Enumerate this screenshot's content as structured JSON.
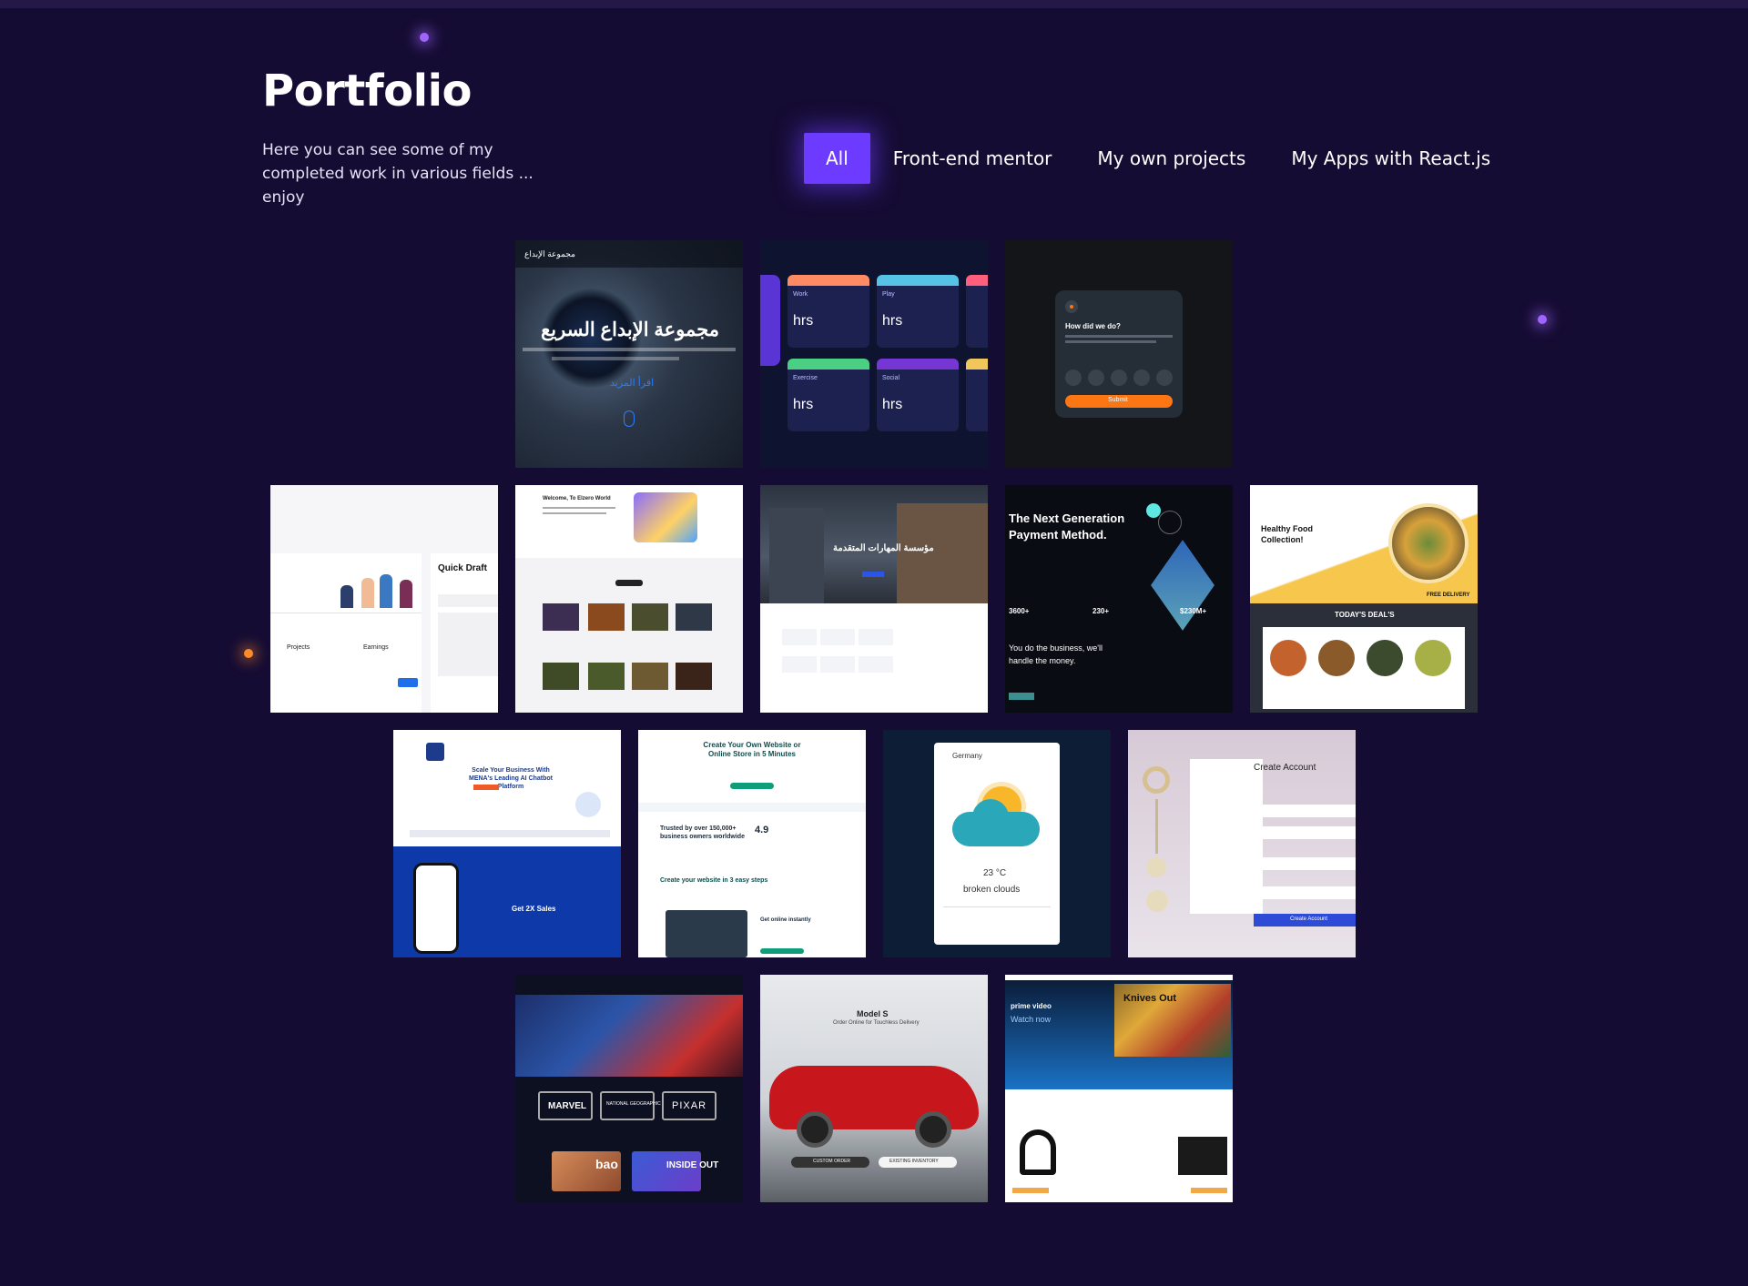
{
  "header": {
    "title": "Portfolio",
    "subtitle": "Here you can see some of my completed work in various fields ... enjoy"
  },
  "filters": [
    {
      "label": "All",
      "active": true
    },
    {
      "label": "Front-end mentor",
      "active": false
    },
    {
      "label": "My own projects",
      "active": false
    },
    {
      "label": "My Apps with React.js",
      "active": false
    }
  ],
  "colors": {
    "background": "#150c33",
    "accent": "#6c3bff",
    "text": "#ffffff"
  },
  "projects": {
    "arabic_agency": {
      "heading": "مجموعة الإبداع السريع",
      "cta": "اقرأ المزيد",
      "brand": "مجموعة الإبداع"
    },
    "time_tracker": {
      "cards": [
        {
          "name": "Work",
          "value": "hrs"
        },
        {
          "name": "Play",
          "value": "hrs"
        },
        {
          "name": "Exercise",
          "value": "hrs"
        },
        {
          "name": "Social",
          "value": "hrs"
        }
      ]
    },
    "rating": {
      "question": "How did we do?",
      "button": "Submit",
      "numbers": [
        "1",
        "2",
        "3",
        "4",
        "5"
      ]
    },
    "dashboard": {
      "heading": "Quick Draft",
      "projects_label": "Projects",
      "earnings_label": "Earnings"
    },
    "elzero": {
      "heading": "Welcome, To Elzero World"
    },
    "arabic_real_estate": {
      "heading": "مؤسسة المهارات المتقدمة"
    },
    "payment": {
      "heading": "The Next Generation Payment Method.",
      "stat1": "3600+",
      "stat2": "230+",
      "stat3": "$230M+",
      "tagline": "You do the business, we'll handle the money."
    },
    "food": {
      "heading": "Healthy Food Collection!",
      "deals": "TODAY'S DEAL'S",
      "badge": "FREE DELIVERY"
    },
    "chatbot": {
      "heading": "Scale Your Business With MENA's Leading AI Chatbot Platform",
      "sales": "Get 2X Sales"
    },
    "website_builder": {
      "heading": "Create Your Own Website or Online Store in 5 Minutes",
      "trust": "Trusted by over 150,000+ business owners worldwide",
      "rating": "4.9",
      "steps": "Create your website in 3 easy steps",
      "online": "Get online instantly"
    },
    "weather": {
      "city": "Germany",
      "temp": "23 °C",
      "condition": "broken clouds"
    },
    "jewelry": {
      "heading": "Create Account",
      "button": "Create Account"
    },
    "disney": {
      "brands": [
        "MARVEL",
        "NATIONAL GEOGRAPHIC",
        "PIXAR"
      ],
      "show1": "bao",
      "show2": "INSIDE OUT"
    },
    "tesla": {
      "heading": "Model S",
      "sub": "Order Online for Touchless Delivery",
      "btn1": "CUSTOM ORDER",
      "btn2": "EXISTING INVENTORY"
    },
    "amazon": {
      "brand": "prime video",
      "watch": "Watch now",
      "movie": "Knives Out"
    }
  }
}
